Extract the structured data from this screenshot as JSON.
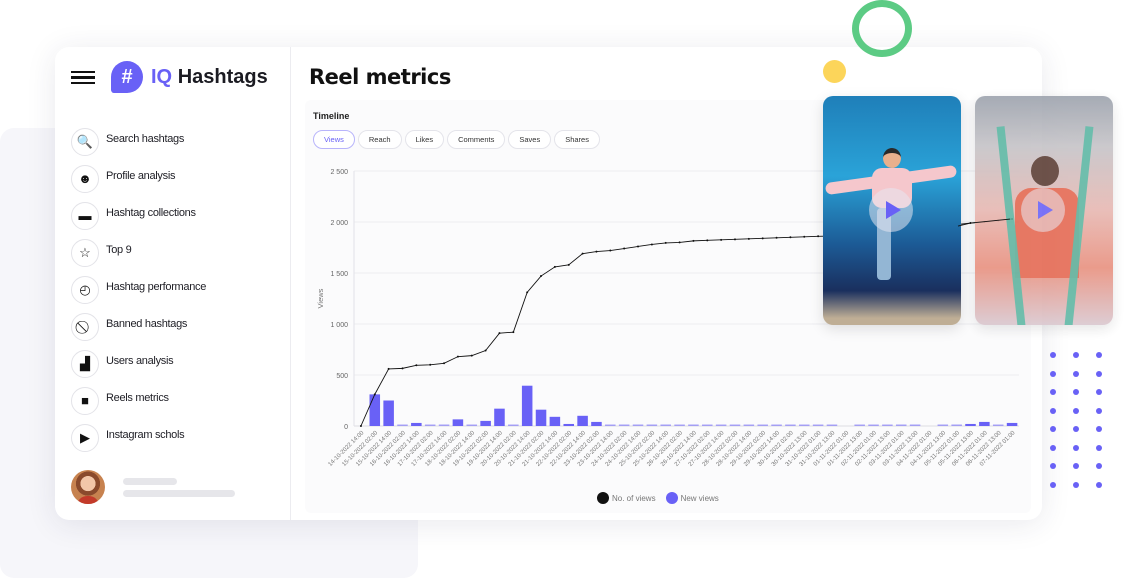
{
  "app": {
    "brand_prefix": "IQ",
    "brand_name": "Hashtags",
    "logo_glyph": "#"
  },
  "sidebar": {
    "items": [
      {
        "label": "Search hashtags",
        "icon": "search-icon",
        "glyph": "🔍"
      },
      {
        "label": "Profile analysis",
        "icon": "face-icon",
        "glyph": "☻"
      },
      {
        "label": "Hashtag collections",
        "icon": "folder-star-icon",
        "glyph": "▬"
      },
      {
        "label": "Top 9",
        "icon": "star-icon",
        "glyph": "☆"
      },
      {
        "label": "Hashtag performance",
        "icon": "gauge-icon",
        "glyph": "◴"
      },
      {
        "label": "Banned hashtags",
        "icon": "ban-icon",
        "glyph": "⃠"
      },
      {
        "label": "Users analysis",
        "icon": "bar-chart-icon",
        "glyph": "▟"
      },
      {
        "label": "Reels metrics",
        "icon": "video-camera-icon",
        "glyph": "■"
      },
      {
        "label": "Instagram schols",
        "icon": "play-message-icon",
        "glyph": "▶"
      }
    ]
  },
  "main": {
    "page_title": "Reel metrics",
    "card_title": "Timeline",
    "tabs": [
      {
        "label": "Views",
        "active": true
      },
      {
        "label": "Reach",
        "active": false
      },
      {
        "label": "Likes",
        "active": false
      },
      {
        "label": "Comments",
        "active": false
      },
      {
        "label": "Saves",
        "active": false
      },
      {
        "label": "Shares",
        "active": false
      }
    ]
  },
  "colors": {
    "accent": "#6961f6",
    "line": "#111111",
    "ring": "#5ccb84",
    "sun": "#fcd55a"
  },
  "chart_data": {
    "type": "bar+line",
    "title": "Timeline",
    "xlabel": "",
    "ylabel": "Views",
    "ylim": [
      0,
      2500
    ],
    "yticks": [
      0,
      500,
      1000,
      1500,
      2000,
      2500
    ],
    "ytick_labels": [
      "0",
      "500",
      "1 000",
      "1 500",
      "2 000",
      "2 500"
    ],
    "grid": true,
    "legend_position": "bottom",
    "categories": [
      "14-10-2022 14:00",
      "15-10-2022 02:00",
      "15-10-2022 14:00",
      "16-10-2022 02:00",
      "16-10-2022 14:00",
      "17-10-2022 02:00",
      "17-10-2022 14:00",
      "18-10-2022 02:00",
      "18-10-2022 14:00",
      "19-10-2022 02:00",
      "19-10-2022 14:00",
      "20-10-2022 02:00",
      "20-10-2022 14:00",
      "21-10-2022 02:00",
      "21-10-2022 14:00",
      "22-10-2022 02:00",
      "22-10-2022 14:00",
      "23-10-2022 02:00",
      "23-10-2022 14:00",
      "24-10-2022 02:00",
      "24-10-2022 14:00",
      "25-10-2022 02:00",
      "25-10-2022 14:00",
      "26-10-2022 02:00",
      "26-10-2022 14:00",
      "27-10-2022 02:00",
      "27-10-2022 14:00",
      "28-10-2022 02:00",
      "28-10-2022 14:00",
      "29-10-2022 02:00",
      "29-10-2022 14:00",
      "30-10-2022 02:00",
      "30-10-2022 13:00",
      "31-10-2022 01:00",
      "31-10-2022 13:00",
      "01-11-2022 01:00",
      "01-11-2022 13:00",
      "02-11-2022 01:00",
      "02-11-2022 13:00",
      "03-11-2022 01:00",
      "03-11-2022 13:00",
      "04-11-2022 01:00",
      "04-11-2022 13:00",
      "05-11-2022 01:00",
      "05-11-2022 13:00",
      "06-11-2022 01:00",
      "06-11-2022 13:00",
      "07-11-2022 01:00"
    ],
    "series": [
      {
        "name": "No. of views",
        "type": "line",
        "color": "#111111",
        "values": [
          0,
          310,
          560,
          565,
          595,
          600,
          615,
          680,
          690,
          740,
          910,
          920,
          1310,
          1470,
          1560,
          1580,
          1690,
          1710,
          1720,
          1740,
          1760,
          1780,
          1795,
          1800,
          1815,
          1820,
          1825,
          1830,
          1835,
          1840,
          1845,
          1850,
          1855,
          1860,
          1862,
          1866,
          1870,
          1875,
          1880,
          1890,
          1900,
          1930,
          1960,
          1975,
          1990,
          2000,
          2015,
          2030
        ]
      },
      {
        "name": "New views",
        "type": "bar",
        "color": "#6961f6",
        "values": [
          0,
          310,
          250,
          5,
          30,
          5,
          15,
          65,
          10,
          50,
          170,
          10,
          395,
          160,
          90,
          20,
          100,
          40,
          10,
          15,
          15,
          15,
          15,
          5,
          15,
          5,
          5,
          5,
          10,
          5,
          5,
          5,
          5,
          5,
          5,
          0,
          5,
          10,
          10,
          15,
          15,
          0,
          15,
          15,
          20,
          40,
          10,
          30
        ]
      }
    ]
  }
}
